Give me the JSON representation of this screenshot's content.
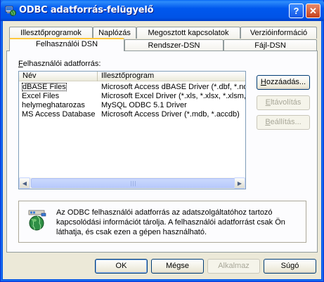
{
  "window": {
    "title": "ODBC adatforrás-felügyelő",
    "help_glyph": "?",
    "close_glyph": "✕"
  },
  "tabs": {
    "row1": [
      "Illesztőprogramok",
      "Naplózás",
      "Megosztott kapcsolatok",
      "Verzióinformáció"
    ],
    "row2": [
      "Felhasználói DSN",
      "Rendszer-DSN",
      "Fájl-DSN"
    ],
    "active": "Felhasználói DSN"
  },
  "panel": {
    "label_access_key": "F",
    "label_rest": "elhasználói adatforrás:",
    "columns": [
      "Név",
      "Illesztőprogram"
    ],
    "rows": [
      {
        "name": "dBASE Files",
        "driver": "Microsoft Access dBASE Driver (*.dbf, *.ndx"
      },
      {
        "name": "Excel Files",
        "driver": "Microsoft Excel Driver (*.xls, *.xlsx, *.xlsm, *.x"
      },
      {
        "name": "helymeghatarozas",
        "driver": "MySQL ODBC 5.1 Driver"
      },
      {
        "name": "MS Access Database",
        "driver": "Microsoft Access Driver (*.mdb, *.accdb)"
      }
    ],
    "scroll_left": "◀",
    "scroll_right": "▶",
    "scroll_thumb": "|||",
    "side_buttons": {
      "add_key": "H",
      "add_rest": "ozzáadás...",
      "remove_key": "E",
      "remove_rest": "ltávolítás",
      "config_key": "B",
      "config_rest": "eállítás..."
    },
    "info_text": "Az ODBC felhasználói adatforrás az adatszolgáltatóhoz tartozó kapcsolódási információt tárolja. A felhasználói adatforrást csak Ön láthatja, és csak ezen a gépen használható."
  },
  "footer": {
    "ok": "OK",
    "cancel": "Mégse",
    "apply": "Alkalmaz",
    "help": "Súgó"
  }
}
